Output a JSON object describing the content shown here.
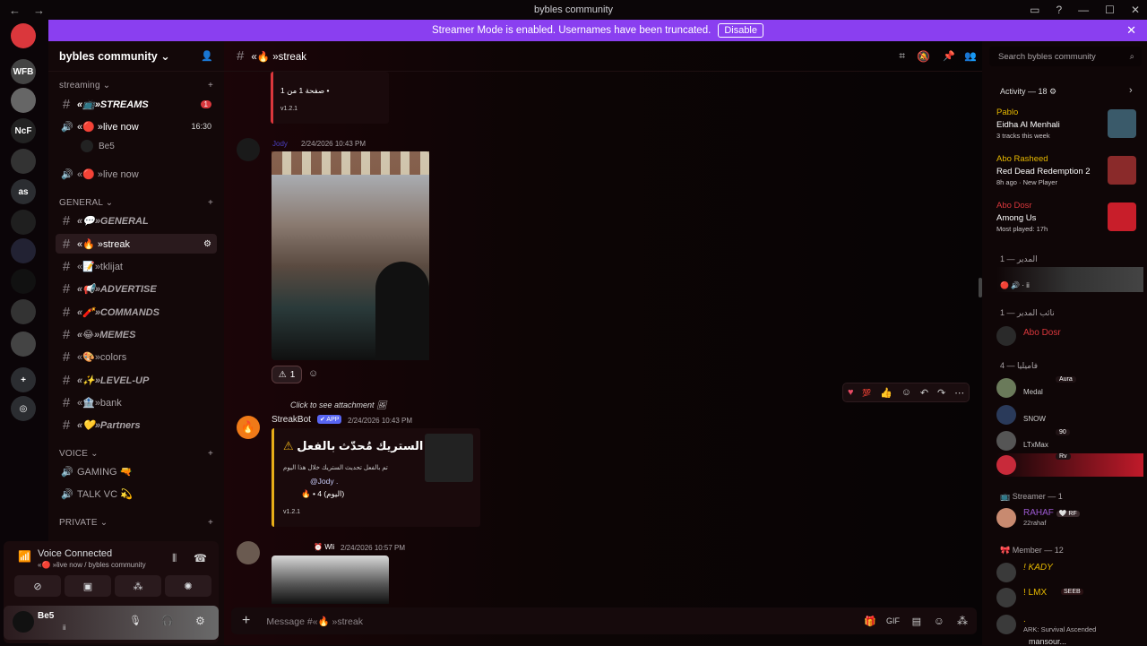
{
  "window": {
    "title": "byble s community",
    "back": "←",
    "forward": "→"
  },
  "banner": {
    "text": "Streamer Mode is enabled. Usernames have been truncated.",
    "button": "Disable"
  },
  "guilds": [
    {
      "label": "",
      "color": "#da373c",
      "badge": ""
    },
    {
      "label": "WFB",
      "color": "#444",
      "badge": ""
    },
    {
      "label": "",
      "color": "#666",
      "badge": "1"
    },
    {
      "label": "NcF",
      "color": "#222",
      "badge": "3"
    },
    {
      "label": "",
      "color": "#333",
      "badge": ""
    },
    {
      "label": "as",
      "color": "#2b2d31",
      "badge": ""
    },
    {
      "label": "",
      "color": "#1f1f1f",
      "badge": "1"
    },
    {
      "label": "",
      "color": "#223",
      "badge": ""
    },
    {
      "label": "",
      "color": "#111",
      "badge": "73"
    },
    {
      "label": "",
      "color": "#333",
      "badge": "4K+"
    },
    {
      "label": "",
      "color": "#444",
      "badge": "1"
    },
    {
      "label": "+",
      "color": "#2b2d31",
      "badge": ""
    },
    {
      "label": "◎",
      "color": "#2b2d31",
      "badge": ""
    }
  ],
  "server": {
    "name": "bybles community"
  },
  "categories": {
    "streaming": "streaming",
    "general": "GENERAL",
    "voice": "VOICE",
    "private": "PRIVATE"
  },
  "channels": {
    "streams": "«📺»STREAMS",
    "streams_badge": "1",
    "live1": "«🔴 »live now",
    "live1_time": "16:30",
    "live_user": "Be5",
    "live2": "«🔴 »live now",
    "general": "«💬»GENERAL",
    "streak": "«🔥 »streak",
    "tklijat": "«📝»tklijat",
    "advertise": "«📢»ADVERTISE",
    "commands": "«🧨»COMMANDS",
    "memes": "«😂»MEMES",
    "colors": "«🎨»colors",
    "levelup": "«✨»LEVEL-UP",
    "bank": "«🏦»bank",
    "partners": "«💛»Partners",
    "gaming": "GAMING 🔫",
    "talk": "TALK VC 💫",
    "priv": "priv..."
  },
  "voice_panel": {
    "status": "Voice Connected",
    "where": "«🔴 »live now / bybles community"
  },
  "user_panel": {
    "name": "Be5",
    "status": "ii"
  },
  "channel_header": {
    "name": "«🔥 »streak"
  },
  "messages": {
    "top_embed_line": "صفحة 1 من 1 •",
    "top_embed_version": "v1.2.1",
    "m1_author": "Jody",
    "m1_time": "2/24/2026 10:43 PM",
    "m1_reaction_count": "1",
    "reply_text": "Click to see attachment",
    "bot_name": "StreakBot",
    "bot_tag": "✔ APP",
    "bot_time": "2/24/2026 10:43 PM",
    "embed_title": "الستريك مُحدّث بالفعل •",
    "embed_line1": "تم بالفعل تحديث الستريك خلال هذا اليوم",
    "embed_line2": "@Jody .",
    "embed_line3": "4 (اليوم)",
    "embed_version": "v1.2.1",
    "m3_tag": "Wli",
    "m3_time": "2/24/2026 10:57 PM"
  },
  "composer": {
    "placeholder": "Message #«🔥 »streak"
  },
  "members": {
    "search": "Search bybles community",
    "activity_header": "Activity — 18",
    "activities": [
      {
        "user": "Pablo",
        "title": "Eidha Al Menhali",
        "sub": "3 tracks this week",
        "color": "#e6b800"
      },
      {
        "user": "Abo Rasheed",
        "title": "Red Dead Redemption 2",
        "sub": "8h ago  ·  New Player",
        "color": "#e6b800"
      },
      {
        "user": "Abo Dosr",
        "title": "Among Us",
        "sub": "Most played: 17h",
        "color": "#da373c"
      }
    ],
    "groups": [
      {
        "header": "المدير — 1"
      },
      {
        "header": "نائب المدير — 1",
        "member": "Abo Dosr"
      },
      {
        "header": "فاميليا — 4",
        "members": [
          "Medal",
          "SNOW",
          "LTxMax",
          ""
        ],
        "tags": [
          "Aura",
          "",
          "90",
          "Rv"
        ]
      },
      {
        "header": "Streamer — 1",
        "member": "RAHAF",
        "tag": "RF",
        "sub": "22rahaf"
      },
      {
        "header": "Member — 12",
        "members": [
          "! KADY",
          "! LMX",
          "."
        ],
        "subs": [
          "",
          "",
          "ARK: Survival Ascended"
        ],
        "tags": [
          "",
          "SEEB",
          ""
        ]
      }
    ],
    "last_partial": "mansour..."
  }
}
